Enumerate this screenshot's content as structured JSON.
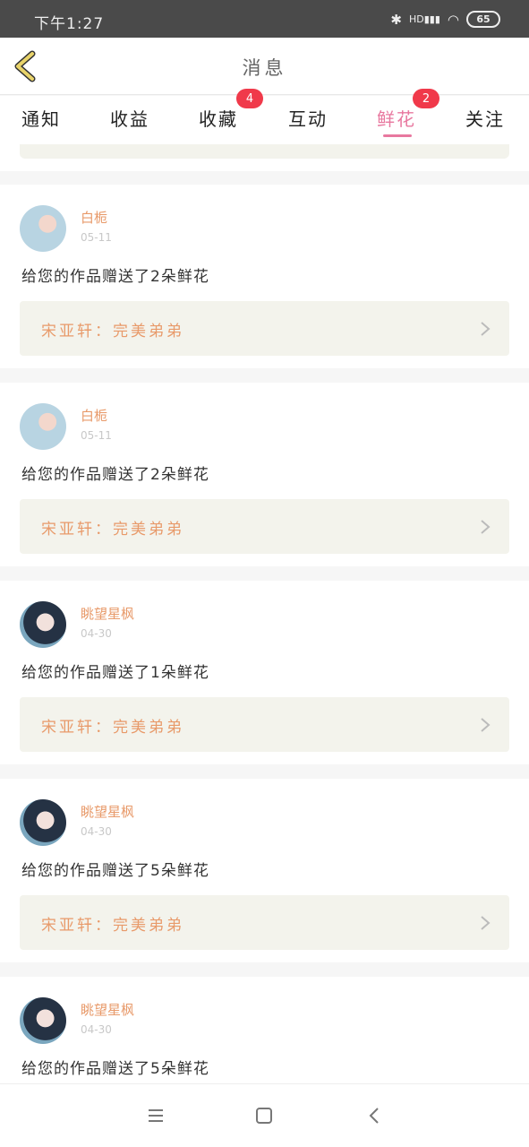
{
  "status_bar": {
    "time": "下午1:27",
    "battery": "65",
    "network": "HD"
  },
  "header": {
    "title": "消息"
  },
  "tabs": [
    {
      "label": "通知",
      "active": false,
      "badge": ""
    },
    {
      "label": "收益",
      "active": false,
      "badge": ""
    },
    {
      "label": "收藏",
      "active": false,
      "badge": "4"
    },
    {
      "label": "互动",
      "active": false,
      "badge": ""
    },
    {
      "label": "鲜花",
      "active": true,
      "badge": "2"
    },
    {
      "label": "关注",
      "active": false,
      "badge": ""
    }
  ],
  "messages": [
    {
      "user": "白栀",
      "date": "05-11",
      "text": "给您的作品赠送了2朵鲜花",
      "work": "宋亚轩：完美弟弟",
      "avatar": "light"
    },
    {
      "user": "白栀",
      "date": "05-11",
      "text": "给您的作品赠送了2朵鲜花",
      "work": "宋亚轩：完美弟弟",
      "avatar": "light"
    },
    {
      "user": "眺望星枫",
      "date": "04-30",
      "text": "给您的作品赠送了1朵鲜花",
      "work": "宋亚轩：完美弟弟",
      "avatar": "dark"
    },
    {
      "user": "眺望星枫",
      "date": "04-30",
      "text": "给您的作品赠送了5朵鲜花",
      "work": "宋亚轩：完美弟弟",
      "avatar": "dark"
    },
    {
      "user": "眺望星枫",
      "date": "04-30",
      "text": "给您的作品赠送了5朵鲜花",
      "work": "",
      "avatar": "dark"
    }
  ],
  "colors": {
    "accent": "#e8789f",
    "name": "#e89a6a",
    "badge": "#f0394a",
    "back": "#e8d36a"
  }
}
